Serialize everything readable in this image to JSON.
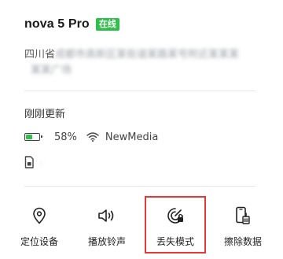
{
  "device": {
    "name": "nova 5 Pro",
    "status_badge": "在线"
  },
  "location": {
    "province": "四川省",
    "rest_line1": "成都市高新区某街道某路某号附近某某某",
    "rest_line2": "某某广场"
  },
  "update": {
    "text": "刚刚更新"
  },
  "status": {
    "battery_percent_label": "58%",
    "battery_level": 0.58,
    "network_name": "NewMedia"
  },
  "sim": {
    "blurred_text": "·"
  },
  "actions": [
    {
      "label": "定位设备",
      "icon": "location-pin-icon"
    },
    {
      "label": "播放铃声",
      "icon": "speaker-icon"
    },
    {
      "label": "丢失模式",
      "icon": "lost-mode-radar-icon"
    },
    {
      "label": "擦除数据",
      "icon": "erase-phone-icon"
    }
  ],
  "colors": {
    "online": "#2fbf4a",
    "highlight": "#e53935"
  }
}
